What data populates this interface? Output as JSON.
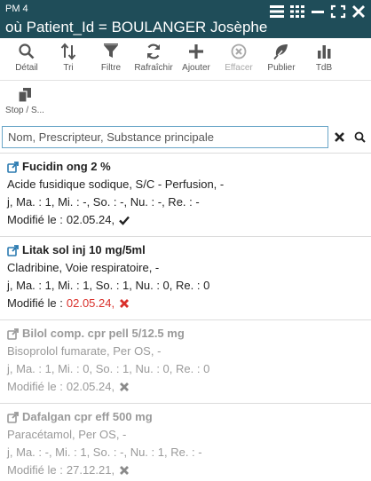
{
  "header": {
    "subtitle": "PM 4",
    "title": "où Patient_Id = BOULANGER Josèphe",
    "icons": [
      "list-view-icon",
      "grid-view-icon",
      "minimize-icon",
      "fullscreen-icon",
      "close-icon"
    ]
  },
  "toolbar": {
    "items": [
      {
        "label": "Détail",
        "icon": "search-icon"
      },
      {
        "label": "Tri",
        "icon": "sort-icon"
      },
      {
        "label": "Filtre",
        "icon": "filter-icon"
      },
      {
        "label": "Rafraîchir",
        "icon": "refresh-icon"
      },
      {
        "label": "Ajouter",
        "icon": "plus-icon"
      },
      {
        "label": "Effacer",
        "icon": "delete-circle-icon",
        "disabled": true
      },
      {
        "label": "Publier",
        "icon": "leaf-icon"
      },
      {
        "label": "TdB",
        "icon": "bar-chart-icon"
      }
    ],
    "row2": [
      {
        "label": "Stop / S...",
        "icon": "copy-icon"
      }
    ]
  },
  "search": {
    "value": "",
    "placeholder": "Nom, Prescripteur, Substance principale"
  },
  "items": [
    {
      "name": "Fucidin ong 2 %",
      "substance": "Acide fusidique sodique, S/C - Perfusion, -",
      "schedule": "j, Ma. : 1, Mi. : -, So. : -, Nu. : -, Re. : -",
      "modified_label": "Modifié le :",
      "modified_date": "02.05.24,",
      "status_icon": "check-icon",
      "active": true,
      "date_color": "#222222",
      "status_color": "#222222"
    },
    {
      "name": "Litak sol inj 10 mg/5ml",
      "substance": "Cladribine, Voie respiratoire, -",
      "schedule": "j, Ma. : 1, Mi. : 1, So. : 1, Nu. : 0, Re. : 0",
      "modified_label": "Modifié le :",
      "modified_date": "02.05.24,",
      "status_icon": "cross-icon",
      "active": true,
      "date_color": "#d9302b",
      "status_color": "#d9302b"
    },
    {
      "name": "Bilol comp. cpr pell 5/12.5 mg",
      "substance": "Bisoprolol fumarate, Per OS, -",
      "schedule": "j, Ma. : 1, Mi. : 0, So. : 1, Nu. : 0, Re. : 0",
      "modified_label": "Modifié le :",
      "modified_date": "02.05.24,",
      "status_icon": "cross-icon",
      "active": false,
      "date_color": "#9a9a9a",
      "status_color": "#9a9a9a"
    },
    {
      "name": "Dafalgan cpr eff 500 mg",
      "substance": "Paracétamol, Per OS, -",
      "schedule": "j, Ma. : -, Mi. : 1, So. : -, Nu. : 1, Re. : -",
      "modified_label": "Modifié le :",
      "modified_date": "27.12.21,",
      "status_icon": "cross-icon",
      "active": false,
      "date_color": "#9a9a9a",
      "status_color": "#9a9a9a"
    }
  ],
  "colors": {
    "header_bg": "#1f4d59",
    "search_border": "#6aa6c8",
    "danger": "#d9302b",
    "muted": "#9a9a9a"
  }
}
